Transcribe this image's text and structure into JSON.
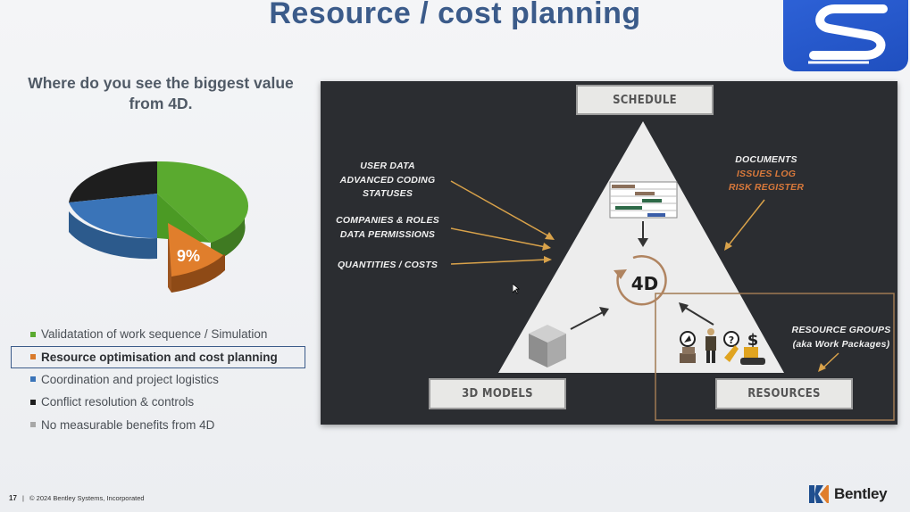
{
  "slide": {
    "title": "Resource / cost planning",
    "question": "Where do you see the biggest value from 4D.",
    "pie_label": "9%",
    "legend": [
      {
        "label": "Validatation of work sequence / Simulation",
        "color": "#5aaa2f"
      },
      {
        "label": "Resource optimisation and cost planning",
        "color": "#d97a2a",
        "selected": true
      },
      {
        "label": "Coordination and project logistics",
        "color": "#3a74b8"
      },
      {
        "label": "Conflict resolution & controls",
        "color": "#1e1e1e"
      },
      {
        "label": "No measurable benefits from 4D",
        "color": "#a7a7a7"
      }
    ]
  },
  "diagram": {
    "schedule": "SCHEDULE",
    "models": "3D MODELS",
    "resources": "RESOURCES",
    "center": "4D",
    "user_data": [
      "USER DATA",
      "ADVANCED CODING",
      "STATUSES"
    ],
    "companies": [
      "COMPANIES & ROLES",
      "DATA PERMISSIONS"
    ],
    "quantities": "QUANTITIES /  COSTS",
    "documents": "DOCUMENTS",
    "issues_log": "ISSUES LOG",
    "risk_register": "RISK REGISTER",
    "resource_groups": [
      "RESOURCE GROUPS",
      "(aka Work Packages)"
    ]
  },
  "footer": {
    "page": "17",
    "copyright": "© 2024 Bentley Systems, Incorporated",
    "brand": "Bentley"
  },
  "colors": {
    "title": "#3b5b8a",
    "accent_orange": "#d9793b",
    "panel_bg": "#2b2d31",
    "logo_blue": "#2d61d6"
  }
}
